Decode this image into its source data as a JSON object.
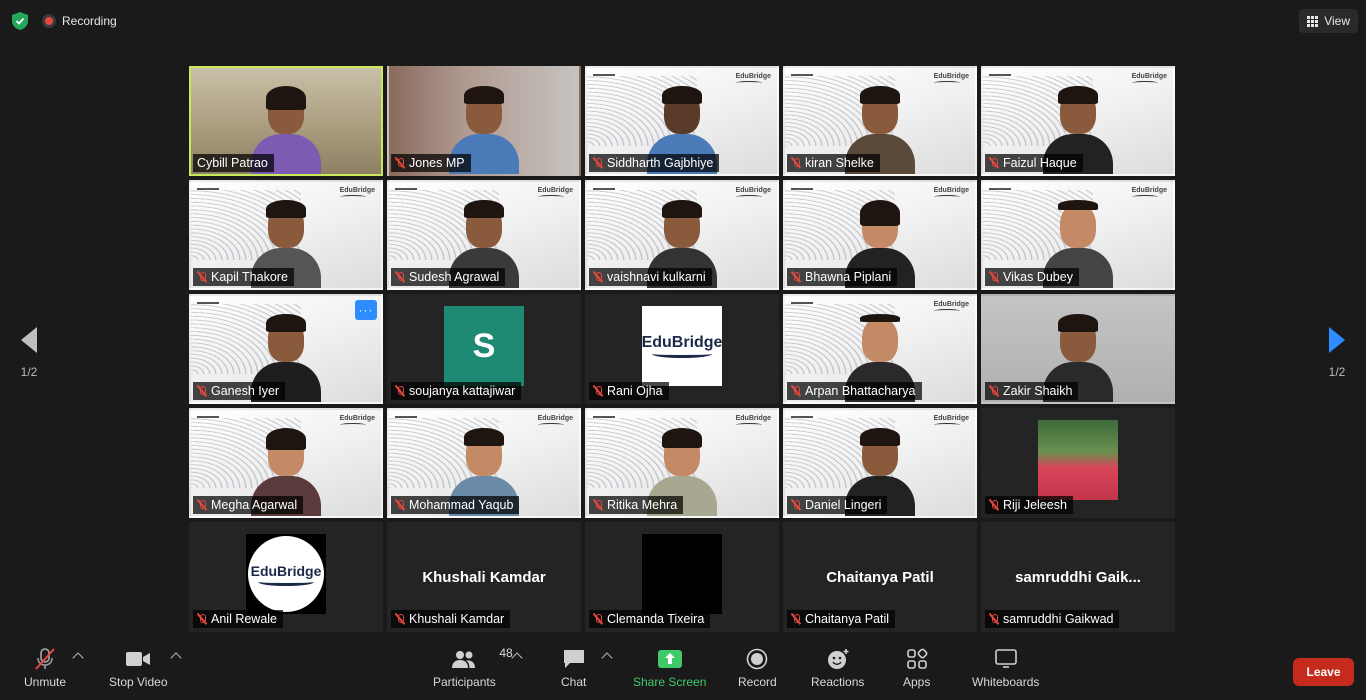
{
  "top_bar": {
    "recording_label": "Recording",
    "view_label": "View"
  },
  "paging": {
    "left_page": "1/2",
    "right_page": "1/2"
  },
  "participants": [
    {
      "name": "Cybill Patrao",
      "muted": false,
      "active": true,
      "tile": "photo"
    },
    {
      "name": "Jones MP",
      "muted": true,
      "tile": "photo"
    },
    {
      "name": "Siddharth Gajbhiye",
      "muted": true,
      "tile": "bg"
    },
    {
      "name": "kiran Shelke",
      "muted": true,
      "tile": "bg"
    },
    {
      "name": "Faizul Haque",
      "muted": true,
      "tile": "bg"
    },
    {
      "name": "Kapil Thakore",
      "muted": true,
      "tile": "bg"
    },
    {
      "name": "Sudesh Agrawal",
      "muted": true,
      "tile": "bg"
    },
    {
      "name": "vaishnavi kulkarni",
      "muted": true,
      "tile": "bg"
    },
    {
      "name": "Bhawna Piplani",
      "muted": true,
      "tile": "bg"
    },
    {
      "name": "Vikas Dubey",
      "muted": true,
      "tile": "bg"
    },
    {
      "name": "Ganesh Iyer",
      "muted": true,
      "tile": "bg",
      "more_menu": "···"
    },
    {
      "name": "soujanya kattajiwar",
      "muted": true,
      "tile": "avatar-letter",
      "avatar_letter": "S"
    },
    {
      "name": "Rani Ojha",
      "muted": true,
      "tile": "avatar-logo",
      "avatar_text": "EduBridge"
    },
    {
      "name": "Arpan Bhattacharya",
      "muted": true,
      "tile": "bg"
    },
    {
      "name": "Zakir Shaikh",
      "muted": true,
      "tile": "photo"
    },
    {
      "name": "Megha Agarwal",
      "muted": true,
      "tile": "bg"
    },
    {
      "name": "Mohammad Yaqub",
      "muted": true,
      "tile": "bg"
    },
    {
      "name": "Ritika Mehra",
      "muted": true,
      "tile": "bg"
    },
    {
      "name": "Daniel Lingeri",
      "muted": true,
      "tile": "bg"
    },
    {
      "name": "Riji Jeleesh",
      "muted": true,
      "tile": "avatar-photo"
    },
    {
      "name": "Anil Rewale",
      "muted": true,
      "tile": "avatar-circle",
      "avatar_text": "EduBridge"
    },
    {
      "name": "Khushali Kamdar",
      "muted": true,
      "tile": "name-only",
      "display_name": "Khushali Kamdar"
    },
    {
      "name": "Clemanda Tixeira",
      "muted": true,
      "tile": "avatar-black"
    },
    {
      "name": "Chaitanya Patil",
      "muted": true,
      "tile": "name-only",
      "display_name": "Chaitanya Patil"
    },
    {
      "name": "samruddhi Gaikwad",
      "muted": true,
      "tile": "name-only",
      "display_name": "samruddhi  Gaik..."
    }
  ],
  "toolbar": {
    "unmute": "Unmute",
    "stop_video": "Stop Video",
    "participants": "Participants",
    "participant_count": "48",
    "chat": "Chat",
    "share_screen": "Share Screen",
    "record": "Record",
    "reactions": "Reactions",
    "apps": "Apps",
    "whiteboards": "Whiteboards",
    "leave": "Leave"
  },
  "colors": {
    "background": "#1a1a1a",
    "accent_blue": "#2d8cff",
    "share_green": "#3fca6a",
    "leave_red": "#c42b1c",
    "active_speaker": "#c9e85a",
    "mute_red": "#e5483d"
  }
}
